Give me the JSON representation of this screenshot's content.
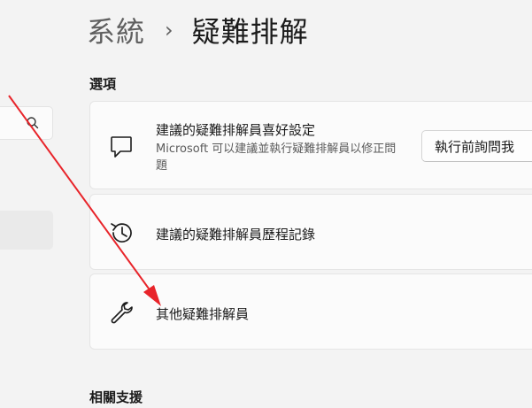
{
  "header": {
    "breadcrumb_parent": "系統",
    "breadcrumb_separator": "›",
    "breadcrumb_current": "疑難排解"
  },
  "sections": {
    "options_title": "選項",
    "related_title": "相關支援"
  },
  "cards": {
    "recommended_prefs": {
      "title": "建議的疑難排解員喜好設定",
      "description": "Microsoft 可以建議並執行疑難排解員以修正問題",
      "button_label": "執行前詢問我"
    },
    "history": {
      "title": "建議的疑難排解員歷程記錄"
    },
    "other": {
      "title": "其他疑難排解員"
    }
  },
  "annotation": {
    "arrow_color": "#e8242a"
  },
  "icons": {
    "search": "search-icon",
    "chat": "chat-bubble-icon",
    "history": "history-icon",
    "wrench": "wrench-icon"
  }
}
